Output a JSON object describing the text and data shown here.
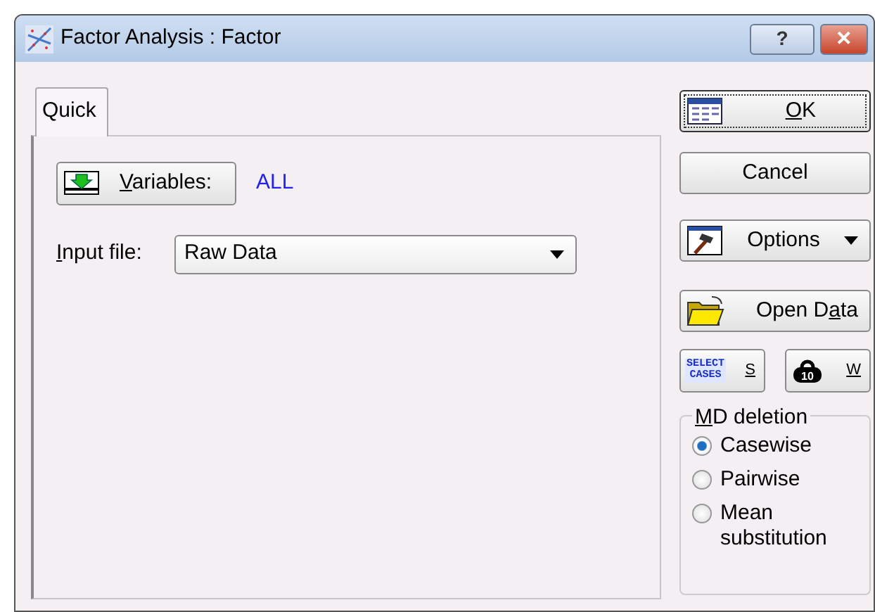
{
  "window": {
    "title": "Factor Analysis : Factor",
    "title_buttons": [
      {
        "kind": "help",
        "label": "?"
      },
      {
        "kind": "close",
        "label": "✕"
      }
    ]
  },
  "tabs": [
    {
      "label": "Quick",
      "selected": true
    }
  ],
  "variables": {
    "label_parts": [
      {
        "text": "V",
        "underlined": true
      },
      {
        "text": "ariables:",
        "underlined": false
      }
    ],
    "value": "ALL"
  },
  "input_file": {
    "label_parts": [
      {
        "text": "I",
        "underlined": true
      },
      {
        "text": "nput file:",
        "underlined": false
      }
    ],
    "value": "Raw Data"
  },
  "buttons": [
    {
      "kind": "ok",
      "label_parts": [
        {
          "text": "O",
          "underlined": true
        },
        {
          "text": "K",
          "underlined": false
        }
      ],
      "default": true
    },
    {
      "kind": "cancel",
      "label_parts": [
        {
          "text": "Cancel",
          "underlined": false
        }
      ],
      "default": false
    },
    {
      "kind": "options",
      "label_parts": [
        {
          "text": "Options",
          "underlined": false
        }
      ],
      "default": false
    },
    {
      "kind": "open",
      "label_parts": [
        {
          "text": "Open D",
          "underlined": false
        },
        {
          "text": "a",
          "underlined": true
        },
        {
          "text": "ta",
          "underlined": false
        }
      ],
      "default": false
    }
  ],
  "small_buttons": [
    {
      "kind": "select",
      "icon_text": [
        "SELECT",
        "CASES"
      ],
      "label_parts": [
        {
          "text": "S",
          "underlined": true
        }
      ]
    },
    {
      "kind": "weight",
      "icon_text": [
        "10"
      ],
      "label_parts": [
        {
          "text": "W",
          "underlined": true
        }
      ]
    }
  ],
  "md_deletion": {
    "label_parts": [
      {
        "text": "M",
        "underlined": true
      },
      {
        "text": "D deletion",
        "underlined": false
      }
    ],
    "options": [
      {
        "label": "Casewise",
        "selected": true
      },
      {
        "label": "Pairwise",
        "selected": false
      },
      {
        "label": "Mean substitution",
        "selected": false
      }
    ]
  }
}
